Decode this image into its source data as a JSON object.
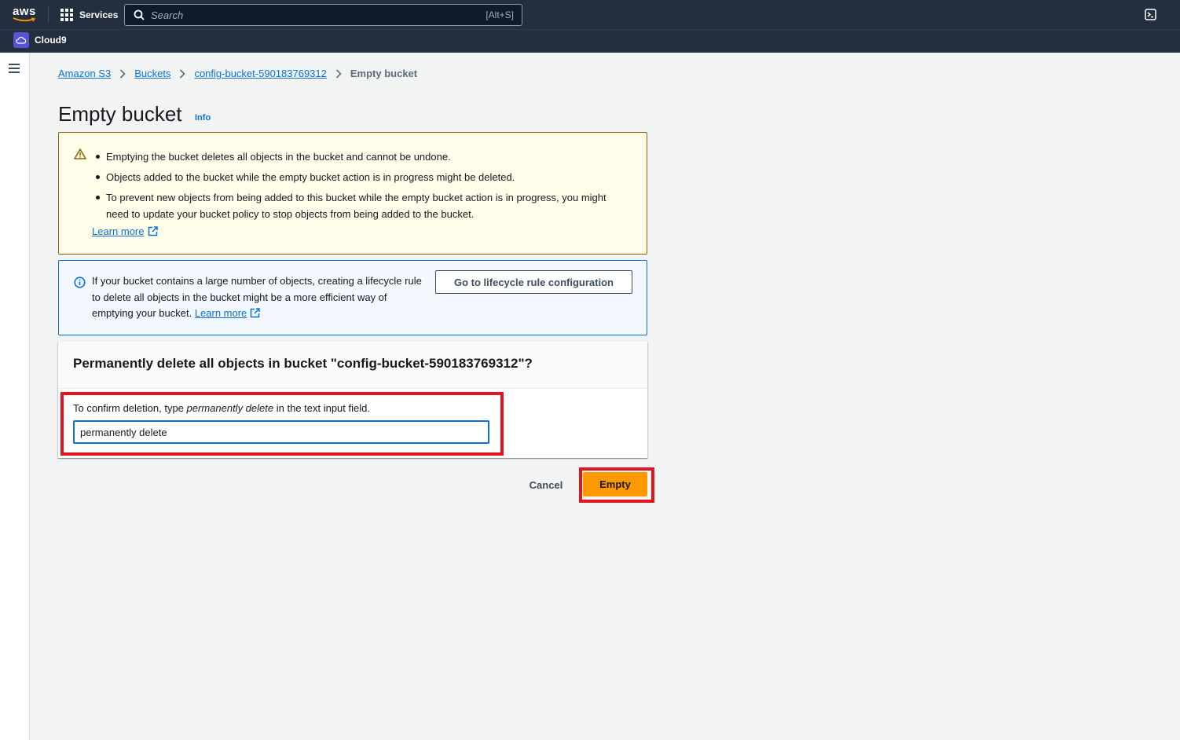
{
  "topnav": {
    "logo": "aws",
    "services_label": "Services",
    "search_placeholder": "Search",
    "search_shortcut": "[Alt+S]"
  },
  "subnav": {
    "favorite_label": "Cloud9"
  },
  "breadcrumb": {
    "items": [
      "Amazon S3",
      "Buckets",
      "config-bucket-590183769312"
    ],
    "current": "Empty bucket"
  },
  "page": {
    "title": "Empty bucket",
    "info_label": "Info"
  },
  "warning": {
    "items": [
      "Emptying the bucket deletes all objects in the bucket and cannot be undone.",
      "Objects added to the bucket while the empty bucket action is in progress might be deleted.",
      "To prevent new objects from being added to this bucket while the empty bucket action is in progress, you might need to update your bucket policy to stop objects from being added to the bucket."
    ],
    "learn_more": "Learn more"
  },
  "info_alert": {
    "text": "If your bucket contains a large number of objects, creating a lifecycle rule to delete all objects in the bucket might be a more efficient way of emptying your bucket.",
    "learn_more": "Learn more",
    "button_label": "Go to lifecycle rule configuration"
  },
  "confirm": {
    "title": "Permanently delete all objects in bucket \"config-bucket-590183769312\"?",
    "label_before": "To confirm deletion, type ",
    "label_em": "permanently delete",
    "label_after": " in the text input field.",
    "input_value": "permanently delete"
  },
  "actions": {
    "cancel": "Cancel",
    "empty": "Empty"
  },
  "colors": {
    "nav_bg": "#232f3e",
    "link": "#0972d3",
    "primary_button": "#ff9900",
    "highlight": "#e0161e",
    "warning_bg": "#fffce9",
    "info_bg": "#f2f8fd"
  }
}
